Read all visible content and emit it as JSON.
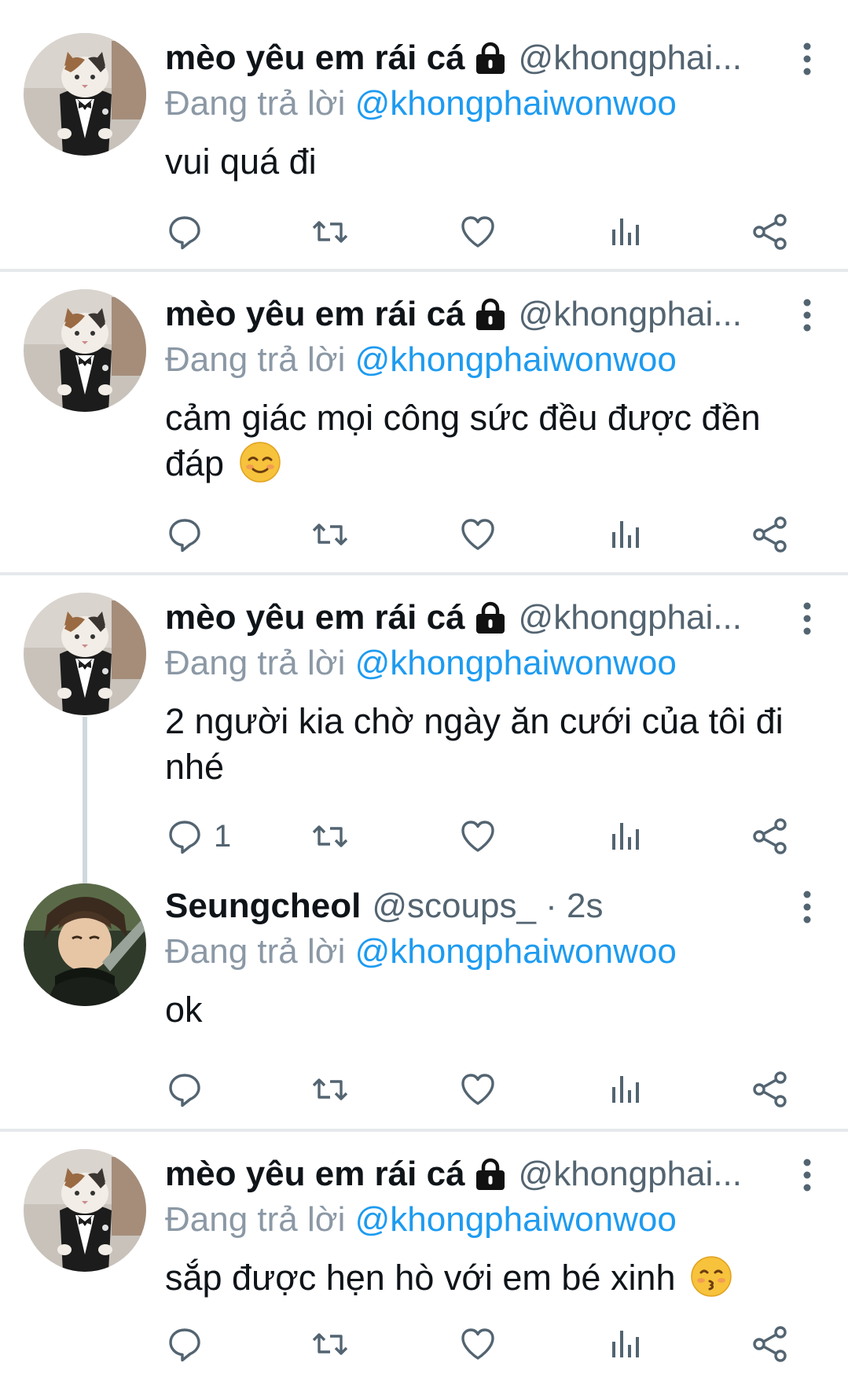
{
  "tweets": [
    {
      "name": "mèo yêu em rái cá",
      "handle": "@khongphai...",
      "reply_prefix": "Đang trả lời",
      "reply_to": "@khongphaiwonwoo",
      "text": "vui quá đi",
      "reply_count": "",
      "avatar": "cat-in-suit"
    },
    {
      "name": "mèo yêu em rái cá",
      "handle": "@khongphai...",
      "reply_prefix": "Đang trả lời",
      "reply_to": "@khongphaiwonwoo",
      "text": "cảm giác mọi công sức đều được đền đáp",
      "emoji": "smiling-face-emoji",
      "reply_count": "",
      "avatar": "cat-in-suit"
    },
    {
      "name": "mèo yêu em rái cá",
      "handle": "@khongphai...",
      "reply_prefix": "Đang trả lời",
      "reply_to": "@khongphaiwonwoo",
      "text": "2 người kia chờ ngày ăn cưới của tôi đi nhé",
      "reply_count": "1",
      "avatar": "cat-in-suit"
    },
    {
      "name": "Seungcheol",
      "handle": "@scoups_ · 2s",
      "reply_prefix": "Đang trả lời",
      "reply_to": "@khongphaiwonwoo",
      "text": "ok",
      "reply_count": "",
      "avatar": "person-photo"
    },
    {
      "name": "mèo yêu em rái cá",
      "handle": "@khongphai...",
      "reply_prefix": "Đang trả lời",
      "reply_to": "@khongphaiwonwoo",
      "text": "sắp được hẹn hò với em bé xinh",
      "emoji": "kissing-face-emoji",
      "reply_count": "",
      "avatar": "cat-in-suit"
    }
  ],
  "colors": {
    "link": "#1d9bf0",
    "secondary_text": "#8b98a5",
    "icon": "#536471",
    "divider": "#e6e9ec"
  }
}
